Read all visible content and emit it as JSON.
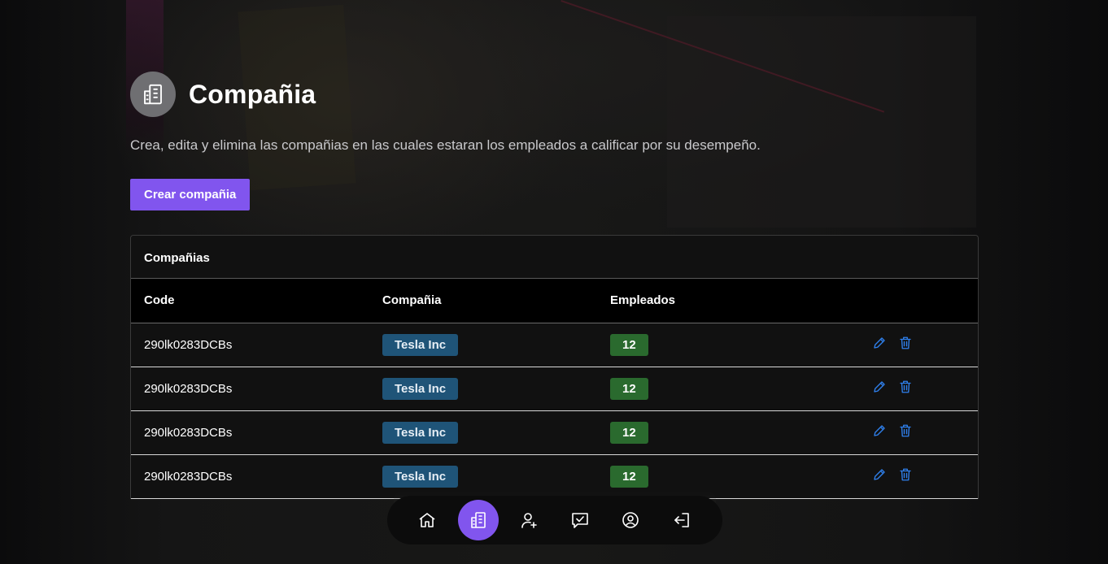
{
  "header": {
    "title": "Compañia",
    "subtitle": "Crea, edita y elimina las compañias en las cuales estaran los empleados a calificar por su desempeño.",
    "icon": "building-icon"
  },
  "create_button": {
    "label": "Crear compañia"
  },
  "card": {
    "title": "Compañias",
    "columns": [
      "Code",
      "Compañia",
      "Empleados",
      ""
    ],
    "rows": [
      {
        "code": "290lk0283DCBs",
        "company": "Tesla Inc",
        "employees": "12"
      },
      {
        "code": "290lk0283DCBs",
        "company": "Tesla Inc",
        "employees": "12"
      },
      {
        "code": "290lk0283DCBs",
        "company": "Tesla Inc",
        "employees": "12"
      },
      {
        "code": "290lk0283DCBs",
        "company": "Tesla Inc",
        "employees": "12"
      }
    ],
    "row_actions": [
      "pencil-icon",
      "trash-icon"
    ]
  },
  "bottom_nav": {
    "items": [
      {
        "icon": "home-icon",
        "active": false
      },
      {
        "icon": "building-icon",
        "active": true
      },
      {
        "icon": "user-add-icon",
        "active": false
      },
      {
        "icon": "chat-check-icon",
        "active": false
      },
      {
        "icon": "account-circle-icon",
        "active": false
      },
      {
        "icon": "logout-icon",
        "active": false
      }
    ]
  },
  "colors": {
    "accent": "#8155ee",
    "company_badge": "#1f5478",
    "count_badge": "#2a6a2e",
    "action_icon": "#2f80ed"
  }
}
